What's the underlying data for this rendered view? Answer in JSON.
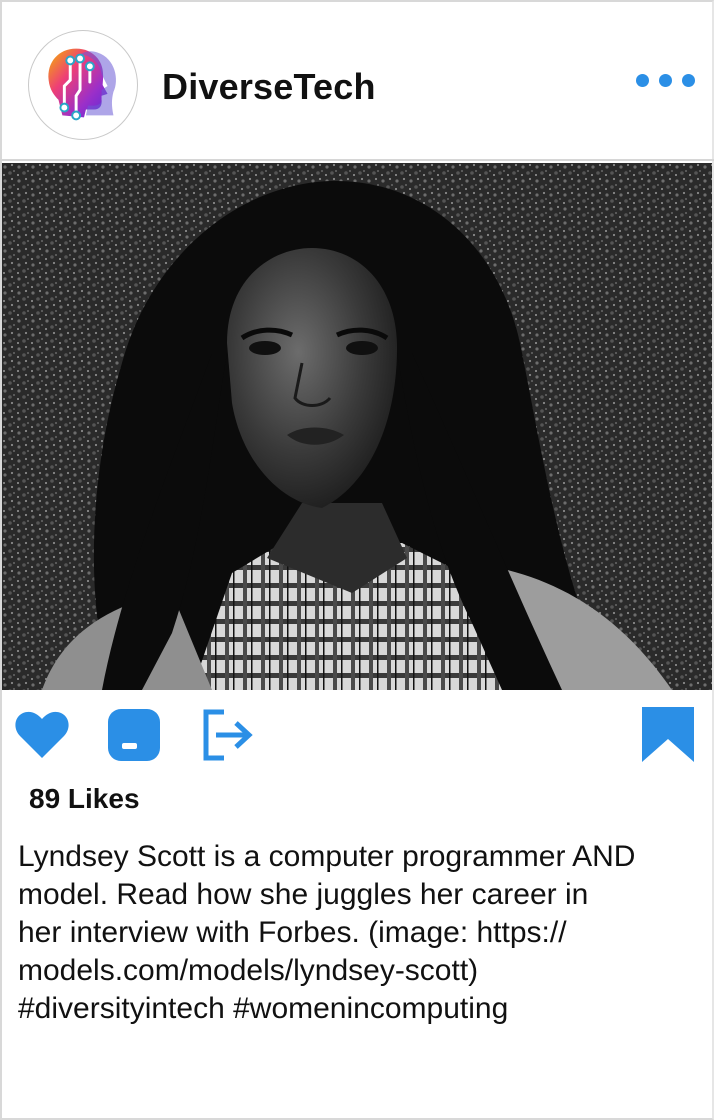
{
  "post": {
    "account": {
      "name": "DiverseTech",
      "avatar_icon": "brain-circuit-logo"
    },
    "more_icon": "more-dots-icon",
    "image_alt": "Black and white portrait of a woman with long dark hair wearing a plaid shirt and denim jacket",
    "actions": {
      "like_icon": "heart-icon",
      "comment_icon": "comment-icon",
      "share_icon": "share-icon",
      "save_icon": "bookmark-icon"
    },
    "likes": "89 Likes",
    "caption_lines": [
      "Lyndsey Scott is a computer programmer AND",
      "model. Read how she juggles her career in",
      "her interview with Forbes. (image: https://",
      "models.com/models/lyndsey-scott)",
      "#diversityintech #womenincomputing"
    ]
  },
  "colors": {
    "accent": "#2b8fe6",
    "text": "#111111",
    "divider": "#d6d6d6"
  }
}
